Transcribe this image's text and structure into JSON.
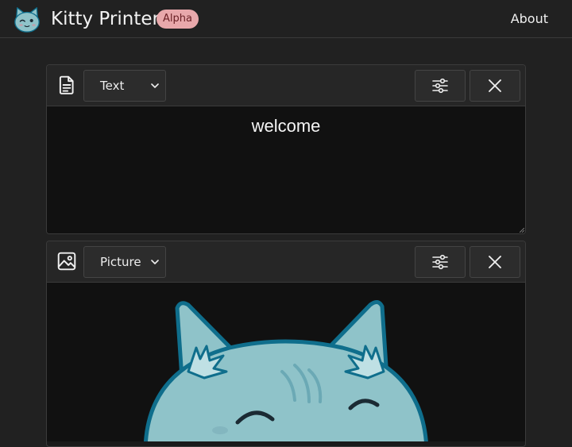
{
  "app": {
    "title": "Kitty Printer",
    "badge": "Alpha",
    "logo_icon": "kitty-face-logo",
    "accent": "#8fc3c9",
    "badge_color": "#e8a8ab"
  },
  "nav": {
    "about_label": "About"
  },
  "cards": [
    {
      "type_icon": "document-icon",
      "type_label": "Text",
      "settings_icon": "sliders-icon",
      "close_icon": "close-icon",
      "content_text": "welcome"
    },
    {
      "type_icon": "image-icon",
      "type_label": "Picture",
      "settings_icon": "sliders-icon",
      "close_icon": "close-icon",
      "content_image": "cat-illustration"
    }
  ],
  "colors": {
    "background": "#212121",
    "card_header": "#262626",
    "content_bg": "#111111",
    "cat_fill": "#8fc3c9",
    "cat_outline": "#0f6e8c"
  }
}
